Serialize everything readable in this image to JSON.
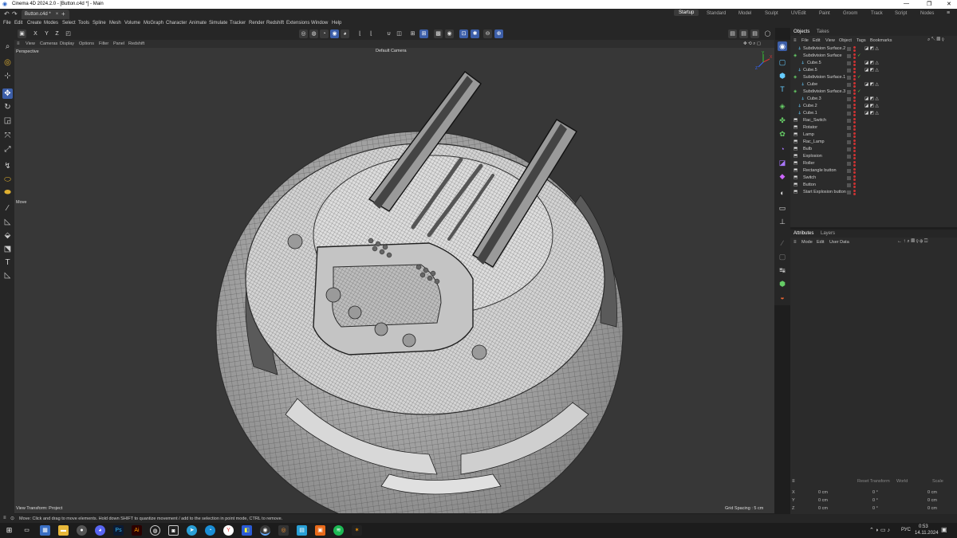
{
  "window": {
    "title": "Cinema 4D 2024.2.0 - [Button.c4d *] - Main",
    "controls": [
      "—",
      "❐",
      "✕"
    ]
  },
  "document_tab": {
    "label": "Button.c4d *",
    "close": "×",
    "add": "+"
  },
  "layout_tabs": [
    "Startup",
    "Standard",
    "Model",
    "Sculpt",
    "UVEdit",
    "Paint",
    "Groom",
    "Track",
    "Script",
    "Nodes"
  ],
  "active_layout": "Startup",
  "menu": [
    "File",
    "Edit",
    "Create",
    "Modes",
    "Select",
    "Tools",
    "Spline",
    "Mesh",
    "Volume",
    "MoGraph",
    "Character",
    "Animate",
    "Simulate",
    "Tracker",
    "Render",
    "Redshift",
    "Extensions",
    "Window",
    "Help"
  ],
  "toolbar": {
    "axes": [
      "X",
      "Y",
      "Z"
    ]
  },
  "viewport": {
    "menu": [
      "View",
      "Cameras",
      "Display",
      "Options",
      "Filter",
      "Panel",
      "Redshift"
    ],
    "label": "Perspective",
    "camera": "Default Camera",
    "tool_hint": "Move",
    "view_transform": "View Transform: Project",
    "grid_spacing": "Grid Spacing : 5 cm",
    "axis": {
      "x": "X",
      "y": "Y",
      "z": "Z"
    }
  },
  "objects_panel": {
    "tabs": [
      "Objects",
      "Takes"
    ],
    "menu": [
      "File",
      "Edit",
      "View",
      "Object",
      "Tags",
      "Bookmarks"
    ],
    "items": [
      {
        "name": "Subdivision Surface.2",
        "indent": 1
      },
      {
        "name": "Subdivision Surface",
        "indent": 0
      },
      {
        "name": "Cube.5",
        "indent": 2
      },
      {
        "name": "Cube.5",
        "indent": 1
      },
      {
        "name": "Subdivision Surface.1",
        "indent": 0
      },
      {
        "name": "Cube",
        "indent": 2
      },
      {
        "name": "Subdivision Surface.3",
        "indent": 0
      },
      {
        "name": "Cube.3",
        "indent": 2
      },
      {
        "name": "Cube.2",
        "indent": 1
      },
      {
        "name": "Cube.1",
        "indent": 1
      },
      {
        "name": "Rac_Switch",
        "indent": 1
      },
      {
        "name": "Rotator",
        "indent": 1
      },
      {
        "name": "Lamp",
        "indent": 1
      },
      {
        "name": "Rac_Lamp",
        "indent": 1
      },
      {
        "name": "Bulb",
        "indent": 1
      },
      {
        "name": "Explosion",
        "indent": 1
      },
      {
        "name": "Roller",
        "indent": 1
      },
      {
        "name": "Rectangle button",
        "indent": 1
      },
      {
        "name": "Switch",
        "indent": 1
      },
      {
        "name": "Button",
        "indent": 1
      },
      {
        "name": "Start Explosion button",
        "indent": 1
      }
    ]
  },
  "attributes_panel": {
    "tabs": [
      "Attributes",
      "Layers"
    ],
    "menu": [
      "Mode",
      "Edit",
      "User Data"
    ]
  },
  "coordinates": {
    "buttons": [
      "Reset Transform",
      "World",
      "Scale"
    ],
    "rows": [
      {
        "axis": "X",
        "pos": "0 cm",
        "rot": "0 °",
        "scale": "0 cm"
      },
      {
        "axis": "Y",
        "pos": "0 cm",
        "rot": "0 °",
        "scale": "0 cm"
      },
      {
        "axis": "Z",
        "pos": "0 cm",
        "rot": "0 °",
        "scale": "0 cm"
      }
    ]
  },
  "status": "Move: Click and drag to move elements. Hold down SHIFT to quantize movement / add to the selection in point mode, CTRL to remove.",
  "taskbar": {
    "language": "РУС",
    "time": "0:53",
    "date": "14.11.2024",
    "apps": [
      "start-icon",
      "task-view-icon",
      "calculator-icon",
      "file-explorer-icon",
      "discord-icon",
      "steam-icon",
      "photoshop-icon",
      "illustrator-icon",
      "github-icon",
      "telegram-icon",
      "edge-icon",
      "yandex-browser-icon",
      "folder-icon",
      "cinema4d-icon",
      "blender-icon",
      "whatsapp-icon",
      "sticky-icon",
      "spotify-icon",
      "winamp-icon"
    ]
  },
  "colors": {
    "accent": "#3c5ea8",
    "viewport_bg": "#373737",
    "panel_bg": "#2b2b2b",
    "check": "#66cc44"
  }
}
